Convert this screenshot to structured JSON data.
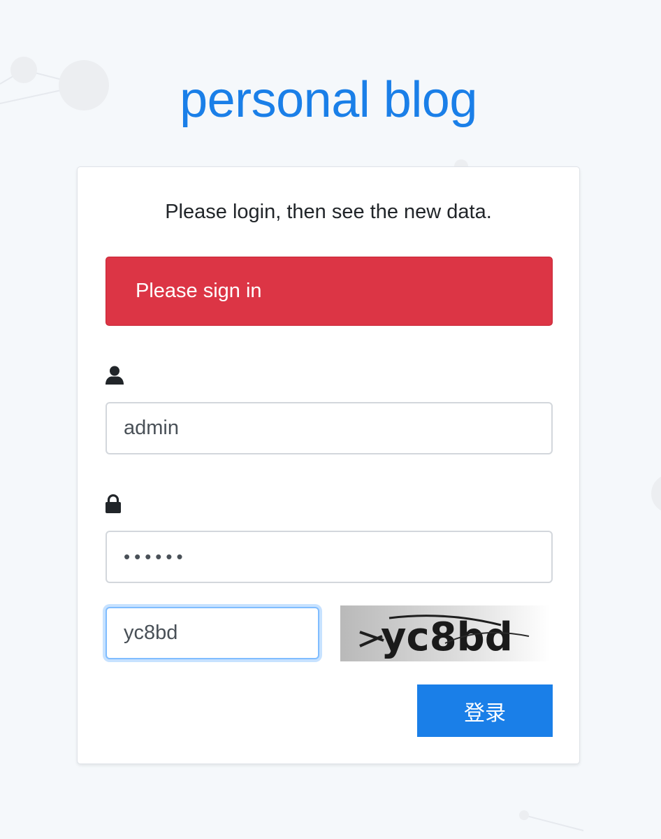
{
  "site": {
    "title": "personal blog"
  },
  "login": {
    "subtitle": "Please login, then see the new data.",
    "alert_text": "Please sign in",
    "username": {
      "icon": "user-icon",
      "value": "admin"
    },
    "password": {
      "icon": "lock-icon",
      "value": "••••••"
    },
    "captcha": {
      "value": "yc8bd",
      "image_text": "yc8bd"
    },
    "submit_label": "登录"
  },
  "colors": {
    "brand": "#1a7fe8",
    "alert": "#dc3545",
    "background": "#f5f8fb"
  }
}
